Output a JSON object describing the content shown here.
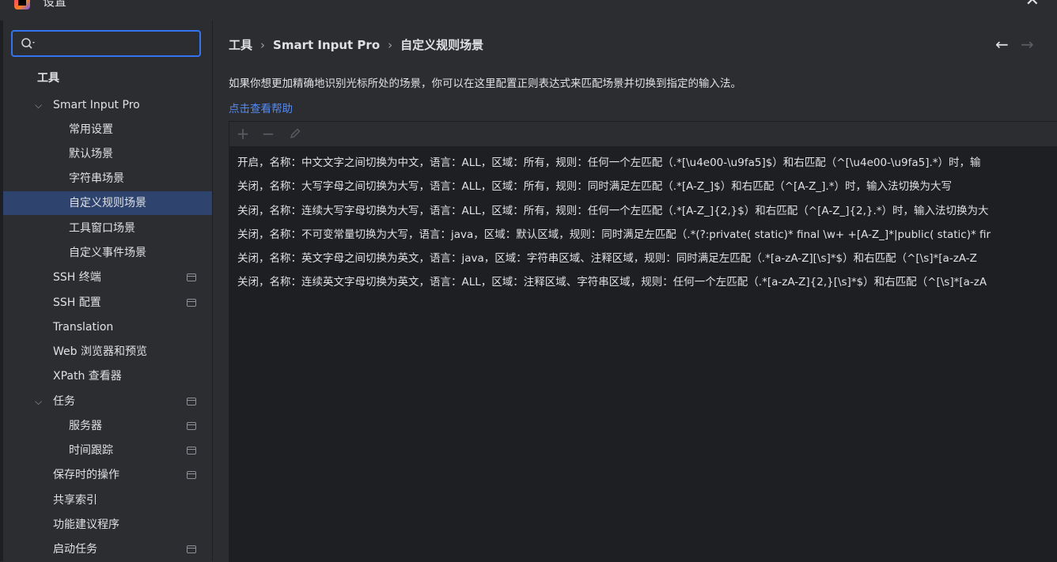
{
  "window": {
    "title": "设置"
  },
  "search": {
    "value": "",
    "placeholder": ""
  },
  "sidebar": {
    "items": [
      {
        "label": "工具"
      },
      {
        "label": "Smart Input Pro"
      },
      {
        "label": "常用设置"
      },
      {
        "label": "默认场景"
      },
      {
        "label": "字符串场景"
      },
      {
        "label": "自定义规则场景"
      },
      {
        "label": "工具窗口场景"
      },
      {
        "label": "自定义事件场景"
      },
      {
        "label": "SSH 终端"
      },
      {
        "label": "SSH 配置"
      },
      {
        "label": "Translation"
      },
      {
        "label": "Web 浏览器和预览"
      },
      {
        "label": "XPath 查看器"
      },
      {
        "label": "任务"
      },
      {
        "label": "服务器"
      },
      {
        "label": "时间跟踪"
      },
      {
        "label": "保存时的操作"
      },
      {
        "label": "共享索引"
      },
      {
        "label": "功能建议程序"
      },
      {
        "label": "启动任务"
      }
    ],
    "selected": "自定义规则场景"
  },
  "breadcrumb": [
    "工具",
    "Smart Input Pro",
    "自定义规则场景"
  ],
  "main": {
    "description": "如果你想更加精确地识别光标所处的场景，你可以在这里配置正则表达式来匹配场景并切换到指定的输入法。",
    "help_link": "点击查看帮助"
  },
  "rules": [
    "开启，名称：中文文字之间切换为中文，语言：ALL，区域：所有，规则：任何一个左匹配（.*[\\u4e00-\\u9fa5]$）和右匹配（^[\\u4e00-\\u9fa5].*）时，输",
    "关闭，名称：大写字母之间切换为大写，语言：ALL，区域：所有，规则：同时满足左匹配（.*[A-Z_]$）和右匹配（^[A-Z_].*）时，输入法切换为大写",
    "关闭，名称：连续大写字母切换为大写，语言：ALL，区域：所有，规则：任何一个左匹配（.*[A-Z_]{2,}$）和右匹配（^[A-Z_]{2,}.*）时，输入法切换为大",
    "关闭，名称：不可变常量切换为大写，语言：java，区域：默认区域，规则：同时满足左匹配（.*(?:private( static)* final \\w+ +[A-Z_]*|public( static)* fir",
    "关闭，名称：英文字母之间切换为英文，语言：java，区域：字符串区域、注释区域，规则：同时满足左匹配（.*[a-zA-Z][\\s]*$）和右匹配（^[\\s]*[a-zA-Z",
    "关闭，名称：连续英文字母切换为英文，语言：ALL，区域：注释区域、字符串区域，规则：任何一个左匹配（.*[a-zA-Z]{2,}[\\s]*$）和右匹配（^[\\s]*[a-zA"
  ],
  "colors": {
    "accent": "#3574f0",
    "link": "#548af7",
    "selection": "#2e436e",
    "background": "#2b2d30"
  },
  "icons": {
    "search": "search-icon",
    "add": "plus-icon",
    "remove": "minus-icon",
    "edit": "pencil-icon",
    "back": "arrow-left-icon",
    "forward": "arrow-right-icon",
    "project": "project-level-icon"
  }
}
